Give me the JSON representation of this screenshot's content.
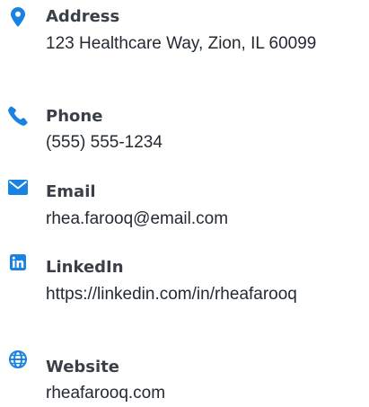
{
  "accent_color": "#1a82e2",
  "contacts": [
    {
      "label": "Address",
      "value": "123 Healthcare Way, Zion, IL 60099",
      "icon": "map-marker-icon"
    },
    {
      "label": "Phone",
      "value": "(555) 555-1234",
      "icon": "phone-icon"
    },
    {
      "label": "Email",
      "value": "rhea.farooq@email.com",
      "icon": "envelope-icon"
    },
    {
      "label": "LinkedIn",
      "value": "https://linkedin.com/in/rheafarooq",
      "icon": "linkedin-icon"
    },
    {
      "label": "Website",
      "value": "rheafarooq.com",
      "icon": "globe-icon"
    }
  ]
}
